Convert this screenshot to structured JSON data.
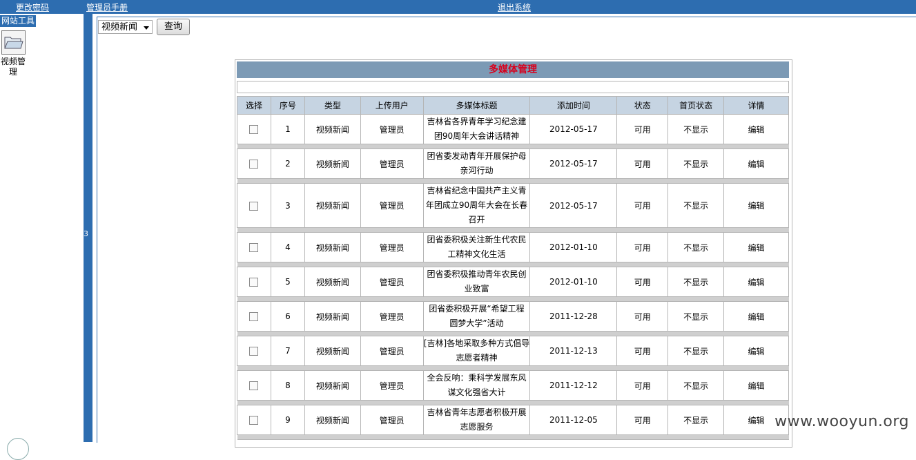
{
  "topbar": {
    "change_password": "更改密码",
    "admin_manual": "管理员手册",
    "logout": "退出系统"
  },
  "sidebar": {
    "tool_title": "网站工具",
    "video_manage_label": "视频管理",
    "divider_label": "3"
  },
  "toolbar": {
    "category_selected": "视频新闻",
    "query_label": "查询"
  },
  "panel": {
    "title": "多媒体管理"
  },
  "table": {
    "headers": [
      "选择",
      "序号",
      "类型",
      "上传用户",
      "多媒体标题",
      "添加时间",
      "状态",
      "首页状态",
      "详情"
    ],
    "rows": [
      {
        "num": "1",
        "type": "视频新闻",
        "user": "管理员",
        "title_l1": "吉林省各界青年学习纪念建",
        "title_l2": "团90周年大会讲话精神",
        "title_l3": "",
        "date": "2012-05-17",
        "status": "可用",
        "home": "不显示",
        "detail": "编辑"
      },
      {
        "num": "2",
        "type": "视频新闻",
        "user": "管理员",
        "title_l1": "团省委发动青年开展保护母",
        "title_l2": "亲河行动",
        "title_l3": "",
        "date": "2012-05-17",
        "status": "可用",
        "home": "不显示",
        "detail": "编辑"
      },
      {
        "num": "3",
        "type": "视频新闻",
        "user": "管理员",
        "title_l1": "吉林省纪念中国共产主义青",
        "title_l2": "年团成立90周年大会在长春",
        "title_l3": "召开",
        "date": "2012-05-17",
        "status": "可用",
        "home": "不显示",
        "detail": "编辑"
      },
      {
        "num": "4",
        "type": "视频新闻",
        "user": "管理员",
        "title_l1": "团省委积极关注新生代农民",
        "title_l2": "工精神文化生活",
        "title_l3": "",
        "date": "2012-01-10",
        "status": "可用",
        "home": "不显示",
        "detail": "编辑"
      },
      {
        "num": "5",
        "type": "视频新闻",
        "user": "管理员",
        "title_l1": "团省委积极推动青年农民创",
        "title_l2": "业致富",
        "title_l3": "",
        "date": "2012-01-10",
        "status": "可用",
        "home": "不显示",
        "detail": "编辑"
      },
      {
        "num": "6",
        "type": "视频新闻",
        "user": "管理员",
        "title_l1": "团省委积极开展“希望工程",
        "title_l2": "圆梦大学”活动",
        "title_l3": "",
        "date": "2011-12-28",
        "status": "可用",
        "home": "不显示",
        "detail": "编辑"
      },
      {
        "num": "7",
        "type": "视频新闻",
        "user": "管理员",
        "title_l1": "[吉林]各地采取多种方式倡导",
        "title_l2": "志愿者精神",
        "title_l3": "",
        "date": "2011-12-13",
        "status": "可用",
        "home": "不显示",
        "detail": "编辑"
      },
      {
        "num": "8",
        "type": "视频新闻",
        "user": "管理员",
        "title_l1": "全会反响：乘科学发展东风",
        "title_l2": "谋文化强省大计",
        "title_l3": "",
        "date": "2011-12-12",
        "status": "可用",
        "home": "不显示",
        "detail": "编辑"
      },
      {
        "num": "9",
        "type": "视频新闻",
        "user": "管理员",
        "title_l1": "吉林省青年志愿者积极开展",
        "title_l2": "志愿服务",
        "title_l3": "",
        "date": "2011-12-05",
        "status": "可用",
        "home": "不显示",
        "detail": "编辑"
      }
    ]
  },
  "watermark": "www.wooyun.org"
}
